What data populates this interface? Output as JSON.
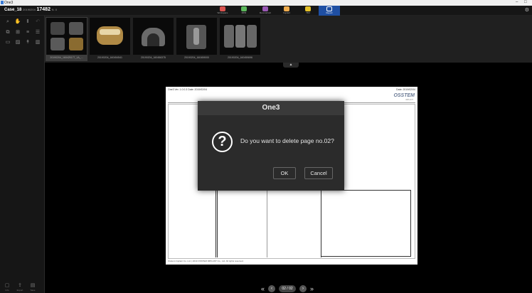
{
  "window": {
    "title": "One3"
  },
  "header": {
    "case_name": "Case_18",
    "case_sub": "20190204",
    "case_id": "17482",
    "case_tail": "N. 0",
    "modules": [
      {
        "label": "Workspace",
        "icon": "workspace-icon",
        "color": "#d9534f",
        "active": false
      },
      {
        "label": "MPR",
        "icon": "mpr-icon",
        "color": "#5cb85c",
        "active": false
      },
      {
        "label": "Reconstruct",
        "icon": "reconstruct-icon",
        "color": "#9b59b6",
        "active": false
      },
      {
        "label": "Implant",
        "icon": "implant-icon",
        "color": "#f0ad4e",
        "active": false
      },
      {
        "label": "TMJ",
        "icon": "tmj-icon",
        "color": "#e6c229",
        "active": false
      },
      {
        "label": "Report",
        "icon": "report-icon",
        "color": "#ffffff",
        "active": true
      }
    ]
  },
  "thumbnails": [
    {
      "caption": "20190204_160425177_1A_...",
      "icon": "axial-slices-thumbnail"
    },
    {
      "caption": "20190204_160454541",
      "icon": "panoramic-thumbnail"
    },
    {
      "caption": "20190204_160456375",
      "icon": "jaw-3d-thumbnail"
    },
    {
      "caption": "20190204_160459000",
      "icon": "cross-section-thumbnail"
    },
    {
      "caption": "20190204_160459696",
      "icon": "implant-slices-thumbnail"
    }
  ],
  "report_page": {
    "header_left": "One3 Ver. 1.0.0.3   Date: 2019/02/04",
    "header_right": "Date: 2019/02/04",
    "logo": "OSSTEM",
    "logo_sub": "IMPLANT",
    "footer": "Osstem Implant Co. Ltd. | 2019 OSSTEM IMPLANT Co., Ltd. All rights reserved."
  },
  "dialog": {
    "title": "One3",
    "message": "Do you want to delete page no.02?",
    "ok_label": "OK",
    "cancel_label": "Cancel",
    "icon": "question-icon"
  },
  "pager": {
    "current": "02 / 02"
  },
  "bottom_tools": [
    {
      "label": "Info",
      "icon": "info-icon"
    },
    {
      "label": "Export",
      "icon": "export-icon"
    },
    {
      "label": "Save",
      "icon": "save-icon"
    }
  ],
  "colors": {
    "accent": "#1f4fa3",
    "dialog_bg": "#2b2b2b"
  }
}
